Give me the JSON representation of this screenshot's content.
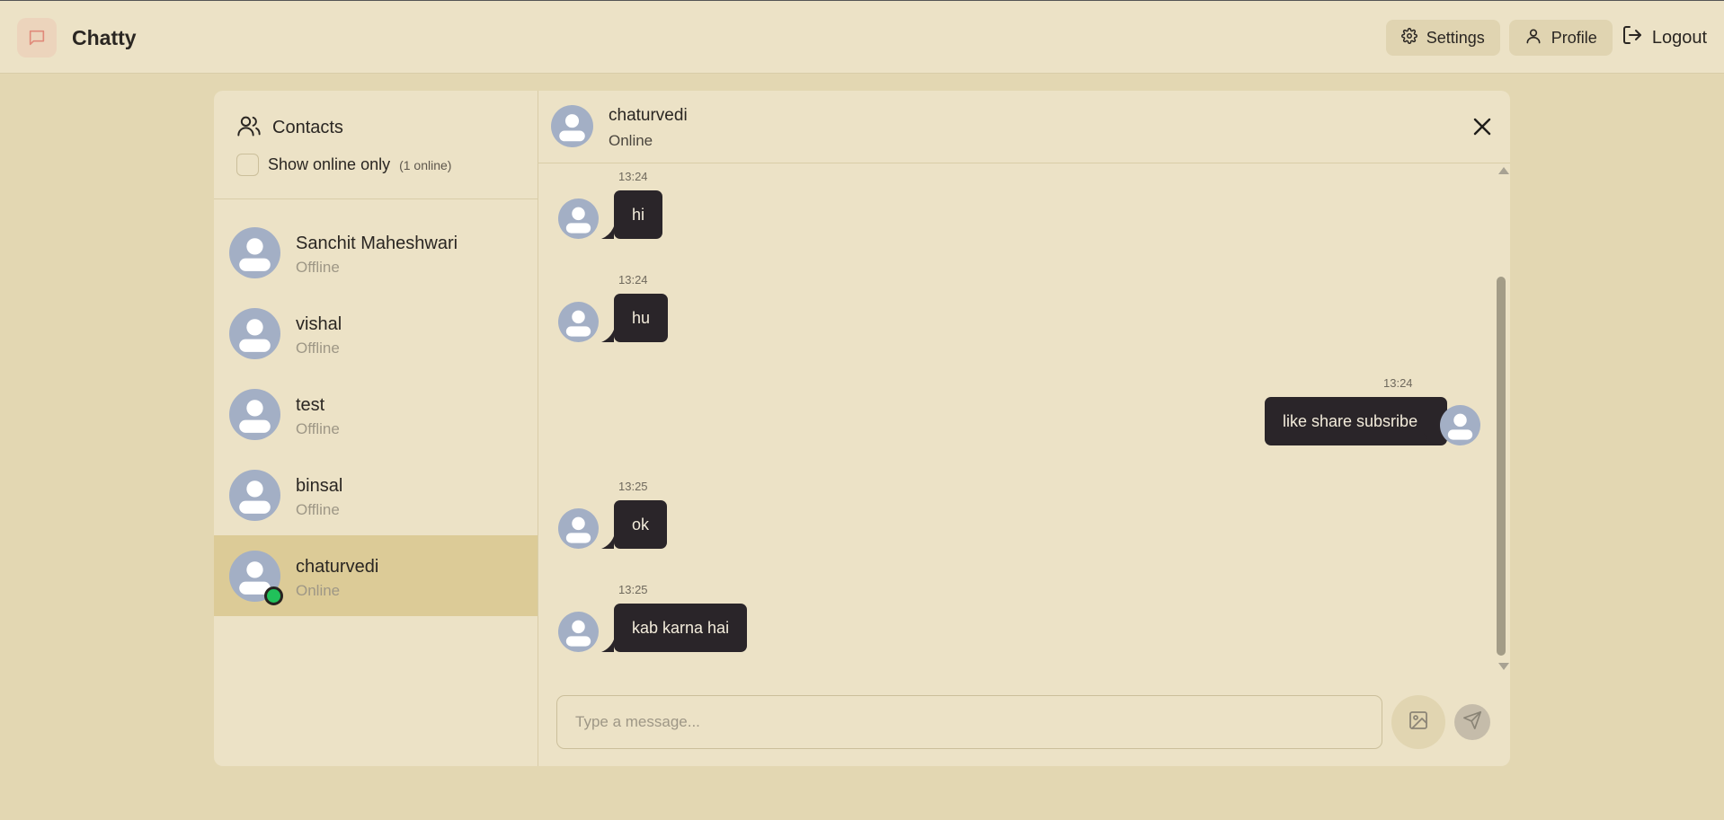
{
  "app": {
    "name": "Chatty",
    "logo_icon": "message-square-icon"
  },
  "nav": {
    "settings_label": "Settings",
    "profile_label": "Profile",
    "logout_label": "Logout"
  },
  "sidebar": {
    "title": "Contacts",
    "filter_label": "Show online only",
    "online_count": "(1 online)",
    "contacts": [
      {
        "name": "Sanchit Maheshwari",
        "status": "Offline"
      },
      {
        "name": "vishal",
        "status": "Offline"
      },
      {
        "name": "test",
        "status": "Offline"
      },
      {
        "name": "binsal",
        "status": "Offline"
      },
      {
        "name": "chaturvedi",
        "status": "Online"
      }
    ]
  },
  "chat": {
    "name": "chaturvedi",
    "status": "Online",
    "messages": [
      {
        "time": "13:24",
        "text": "hi",
        "side": "left"
      },
      {
        "time": "13:24",
        "text": "hu",
        "side": "left"
      },
      {
        "time": "13:24",
        "text": "like share subsribe",
        "side": "right"
      },
      {
        "time": "13:25",
        "text": "ok",
        "side": "left"
      },
      {
        "time": "13:25",
        "text": "kab karna hai",
        "side": "left"
      }
    ]
  },
  "composer": {
    "placeholder": "Type a message..."
  },
  "colors": {
    "page_bg": "#e3d7b2",
    "panel_bg": "#ece2c6",
    "active_contact_bg": "#dccb97",
    "bubble_bg": "#2a2529",
    "online_green": "#21c15a"
  }
}
